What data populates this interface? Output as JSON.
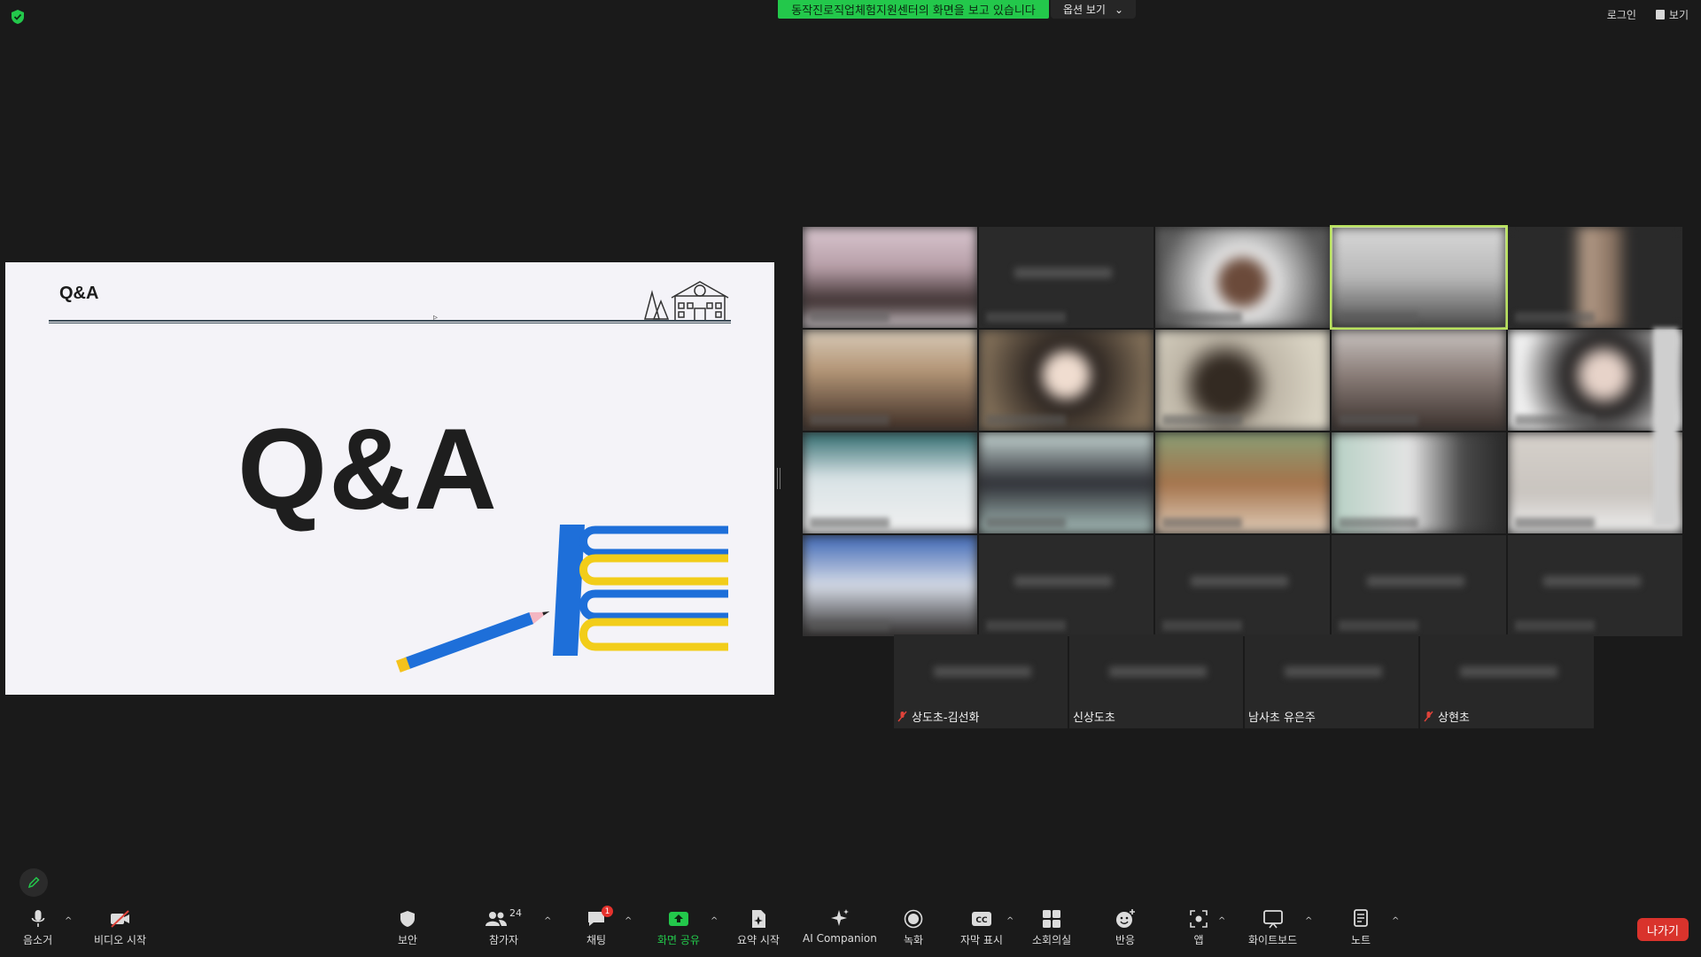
{
  "banner": {
    "sharing_text": "동작진로직업체험지원센터의 화면을 보고 있습니다",
    "view_options_label": "옵션 보기"
  },
  "top_right": {
    "login_label": "로그인",
    "view_label": "보기"
  },
  "slide": {
    "small_title": "Q&A",
    "big_title": "Q&A"
  },
  "gallery": {
    "bottom_row_names": [
      "상도초-김선화",
      "신상도초",
      "남사초 유은주",
      "상현초"
    ]
  },
  "toolbar": {
    "mute": "음소거",
    "video": "비디오 시작",
    "security": "보안",
    "participants": "참가자",
    "participants_count": "24",
    "chat": "채팅",
    "chat_badge": "1",
    "share": "화면 공유",
    "summary": "요약 시작",
    "ai": "AI Companion",
    "record": "녹화",
    "captions": "자막 표시",
    "breakout": "소회의실",
    "reactions": "반응",
    "apps": "앱",
    "whiteboard": "화이트보드",
    "notes": "노트",
    "leave": "나가기"
  },
  "colors": {
    "accent_green": "#23c84b",
    "leave_red": "#d9332c",
    "active_speaker": "#b9e25e"
  }
}
